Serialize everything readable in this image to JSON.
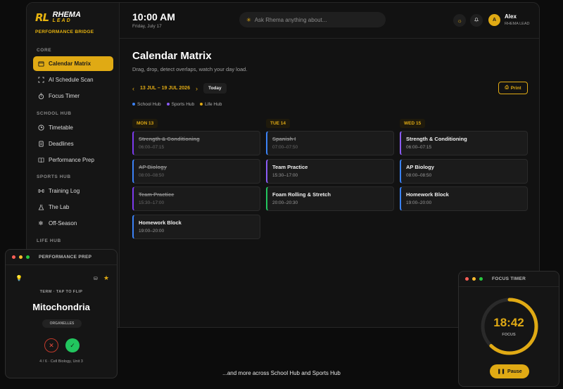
{
  "brand": {
    "logo_mark": "RL",
    "logo_word": "RHEMA",
    "logo_word2": "LEAD",
    "subtitle": "PERFORMANCE BRIDGE"
  },
  "sidebar": {
    "sections": [
      {
        "label": "CORE"
      },
      {
        "label": "SCHOOL HUB"
      },
      {
        "label": "SPORTS HUB"
      },
      {
        "label": "LIFE HUB"
      }
    ],
    "items": [
      {
        "label": "Calendar Matrix",
        "icon": "calendar-icon",
        "active": true
      },
      {
        "label": "AI Schedule Scan",
        "icon": "scan-icon"
      },
      {
        "label": "Focus Timer",
        "icon": "timer-icon"
      },
      {
        "label": "Timetable",
        "icon": "clock-icon"
      },
      {
        "label": "Deadlines",
        "icon": "document-icon"
      },
      {
        "label": "Performance Prep",
        "icon": "book-icon"
      },
      {
        "label": "Training Log",
        "icon": "dumbbell-icon"
      },
      {
        "label": "The Lab",
        "icon": "flask-icon"
      },
      {
        "label": "Off-Season",
        "icon": "snowflake-icon"
      }
    ]
  },
  "topbar": {
    "time": "10:00 AM",
    "date": "Friday, July 17",
    "search_placeholder": "Ask Rhema anything about...",
    "user_initial": "A",
    "user_name": "Alex",
    "user_role": "RHEMA LEAD"
  },
  "main": {
    "title": "Calendar Matrix",
    "subtitle": "Drag, drop, detect overlaps, watch your day load.",
    "week_range": "13 JUL – 19 JUL 2026",
    "today_label": "Today",
    "print_label": "Print",
    "legend": [
      {
        "label": "School Hub",
        "color": "#3b82f6"
      },
      {
        "label": "Sports Hub",
        "color": "#8b5cf6"
      },
      {
        "label": "Life Hub",
        "color": "#e0aa14"
      }
    ],
    "days": [
      {
        "label": "MON 13",
        "events": [
          {
            "title": "Strength & Conditioning",
            "time": "06:00–07:15",
            "done": true,
            "color": "#7c3aed"
          },
          {
            "title": "AP Biology",
            "time": "08:00–08:50",
            "done": true,
            "color": "#3b82f6"
          },
          {
            "title": "Team Practice",
            "time": "15:30–17:00",
            "done": true,
            "color": "#7c3aed"
          },
          {
            "title": "Homework Block",
            "time": "19:00–20:00",
            "done": false,
            "color": "#3b82f6"
          }
        ]
      },
      {
        "label": "TUE 14",
        "events": [
          {
            "title": "Spanish I",
            "time": "07:00–07:50",
            "done": true,
            "color": "#3b82f6"
          },
          {
            "title": "Team Practice",
            "time": "15:30–17:00",
            "done": false,
            "color": "#8b5cf6"
          },
          {
            "title": "Foam Rolling & Stretch",
            "time": "20:00–20:30",
            "done": false,
            "color": "#22c55e"
          }
        ]
      },
      {
        "label": "WED 15",
        "events": [
          {
            "title": "Strength & Conditioning",
            "time": "06:00–07:15",
            "done": false,
            "color": "#8b5cf6"
          },
          {
            "title": "AP Biology",
            "time": "08:00–08:50",
            "done": false,
            "color": "#3b82f6"
          },
          {
            "title": "Homework Block",
            "time": "19:00–20:00",
            "done": false,
            "color": "#3b82f6"
          }
        ]
      }
    ]
  },
  "prep_window": {
    "title": "PERFORMANCE PREP",
    "term_label": "TERM · TAP TO FLIP",
    "term": "Mitochondria",
    "tag": "ORGANELLES",
    "deck_info": "4 / 6 · Cell Biology, Unit 3"
  },
  "timer_window": {
    "title": "FOCUS TIMER",
    "time": "18:42",
    "mode": "FOCUS",
    "progress": 0.62,
    "pause_label": "Pause"
  },
  "footer_note": "...and more across School Hub and Sports Hub"
}
